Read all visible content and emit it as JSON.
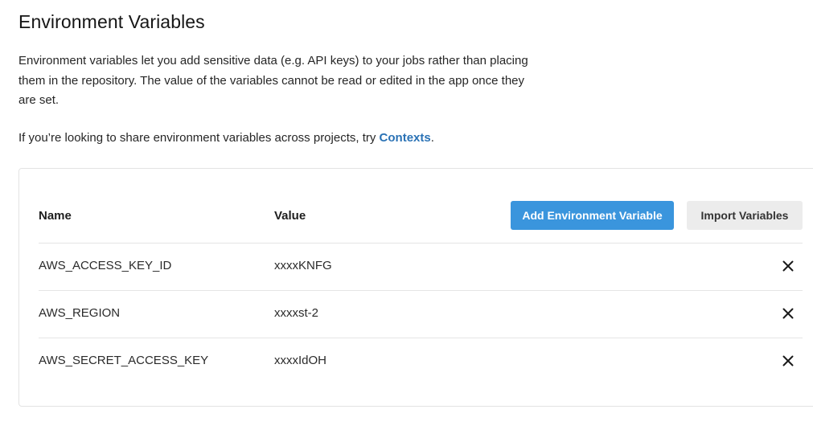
{
  "page": {
    "title": "Environment Variables",
    "description": "Environment variables let you add sensitive data (e.g. API keys) to your jobs rather than placing them in the repository. The value of the variables cannot be read or edited in the app once they are set.",
    "contexts_prefix": "If you’re looking to share environment variables across projects, try ",
    "contexts_link": "Contexts",
    "contexts_suffix": "."
  },
  "table": {
    "headers": {
      "name": "Name",
      "value": "Value"
    },
    "add_button": "Add Environment Variable",
    "import_button": "Import Variables",
    "rows": [
      {
        "name": "AWS_ACCESS_KEY_ID",
        "value": "xxxxKNFG"
      },
      {
        "name": "AWS_REGION",
        "value": "xxxxst-2"
      },
      {
        "name": "AWS_SECRET_ACCESS_KEY",
        "value": "xxxxIdOH"
      }
    ]
  },
  "colors": {
    "primary": "#3a95dd",
    "link": "#2a72b5"
  },
  "icons": {
    "delete": "close-icon"
  }
}
